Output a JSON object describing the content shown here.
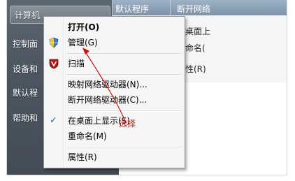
{
  "start_menu": {
    "items": [
      {
        "label": "计算机"
      },
      {
        "label": "控制面"
      },
      {
        "label": "设备和"
      },
      {
        "label": "默认程"
      },
      {
        "label": "帮助和"
      }
    ]
  },
  "background_window": {
    "header_left": "默认程序",
    "header_right": "断开网络",
    "rows": [
      "在桌面上",
      "重命名(",
      "属性(R)"
    ]
  },
  "context_menu": {
    "items": [
      {
        "label": "打开(O)",
        "bold": true
      },
      {
        "label": "管理(G)",
        "icon": "shield-icon"
      },
      {
        "label": "扫描",
        "icon": "antivirus-shield-icon"
      },
      {
        "label": "映射网络驱动器(N)..."
      },
      {
        "label": "断开网络驱动器(C)..."
      },
      {
        "label": "在桌面上显示(S)",
        "checked": true
      },
      {
        "label": "重命名(M)"
      },
      {
        "label": "属性(R)"
      }
    ]
  },
  "annotation": {
    "text": "选择",
    "color": "#cc1010"
  },
  "colors": {
    "start_pane": "#4c5661",
    "menu_bg": "#f5f5f5",
    "annotation": "#cc1010"
  }
}
